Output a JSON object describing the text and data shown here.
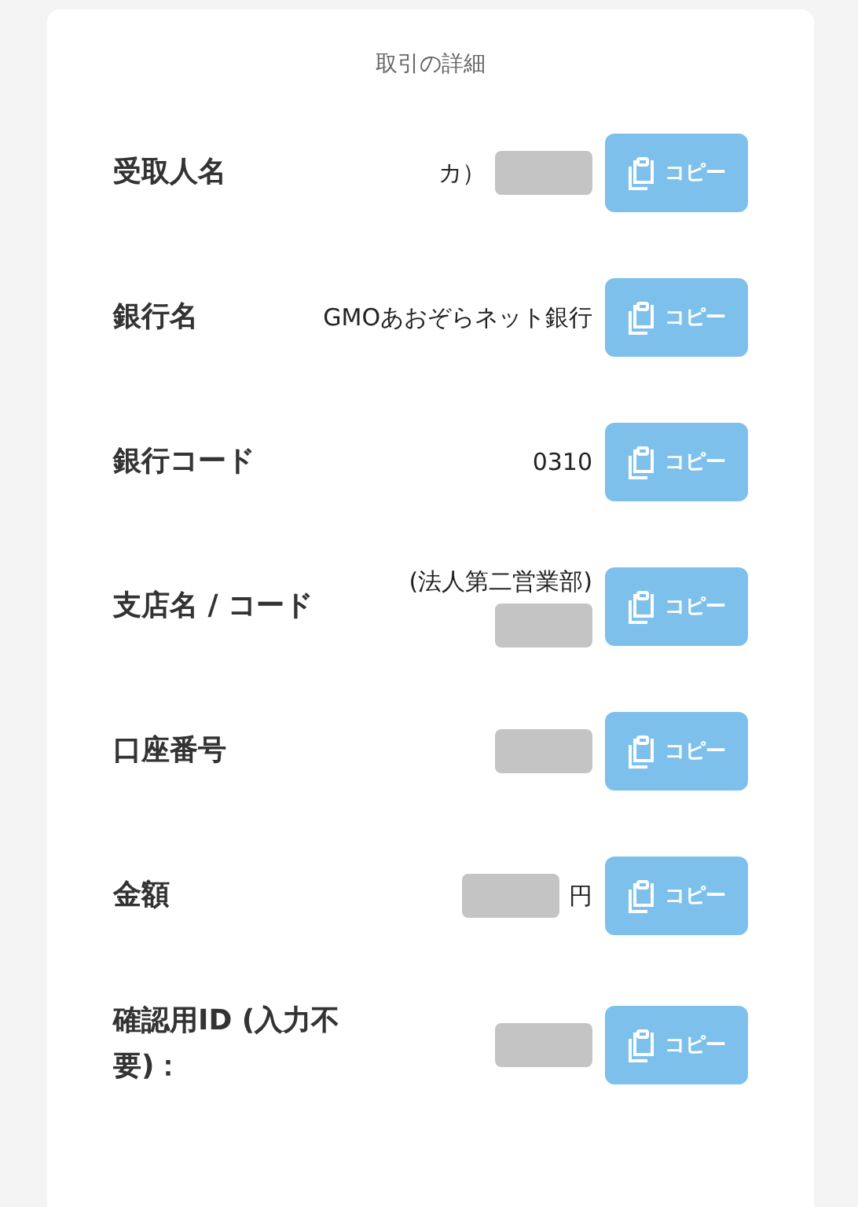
{
  "title": "取引の詳細",
  "rows": [
    {
      "label": "受取人名",
      "value": [
        {
          "kind": "text",
          "text": "カ）"
        },
        {
          "kind": "redaction"
        }
      ],
      "button": "コピー"
    },
    {
      "label": "銀行名",
      "value": [
        {
          "kind": "text",
          "text": "GMOあおぞらネット銀行"
        }
      ],
      "button": "コピー"
    },
    {
      "label": "銀行コード",
      "value": [
        {
          "kind": "text",
          "text": "0310"
        }
      ],
      "button": "コピー"
    },
    {
      "label": "支店名 / コード",
      "value": [
        {
          "kind": "text",
          "text": "(法人第二営業部)"
        },
        {
          "kind": "redaction"
        }
      ],
      "button": "コピー"
    },
    {
      "label": "口座番号",
      "value": [
        {
          "kind": "redaction"
        }
      ],
      "button": "コピー"
    },
    {
      "label": "金額",
      "value": [
        {
          "kind": "redaction"
        },
        {
          "kind": "text",
          "text": "円"
        }
      ],
      "button": "コピー"
    },
    {
      "label": "確認用ID (入力不要)：",
      "value": [
        {
          "kind": "redaction"
        }
      ],
      "button": "コピー"
    }
  ]
}
